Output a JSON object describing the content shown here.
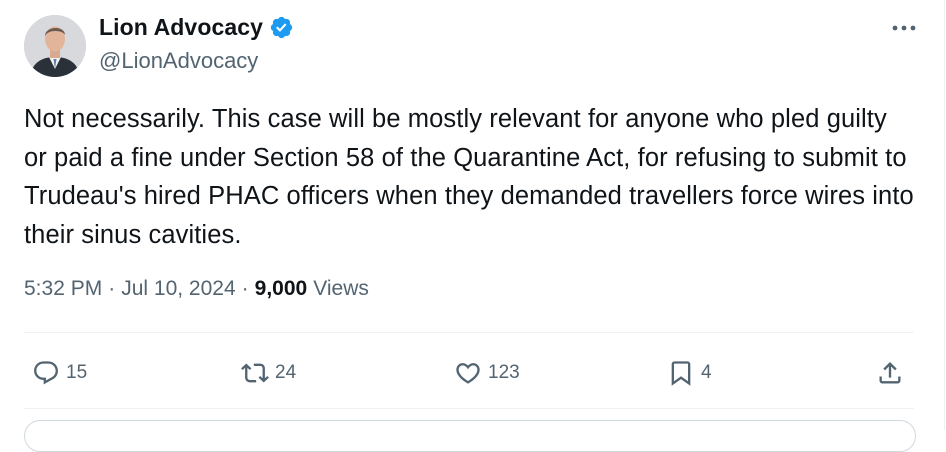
{
  "author": {
    "display_name": "Lion Advocacy",
    "handle": "@LionAdvocacy",
    "verified_icon": "verified-badge-icon",
    "avatar_icon": "avatar"
  },
  "tweet": {
    "text": "Not necessarily. This case will be mostly relevant for anyone who pled guilty or paid a fine under Section 58 of the Quarantine Act, for refusing to submit to Trudeau's hired PHAC officers when they demanded travellers force wires into their sinus cavities.",
    "time": "5:32 PM",
    "separator": "·",
    "date": "Jul 10, 2024",
    "views_count": "9,000",
    "views_label": "Views"
  },
  "actions": {
    "replies": "15",
    "reposts": "24",
    "likes": "123",
    "bookmarks": "4"
  },
  "colors": {
    "text": "#0f1419",
    "secondary": "#536471",
    "verified": "#1d9bf0",
    "divider": "#eff3f4"
  }
}
